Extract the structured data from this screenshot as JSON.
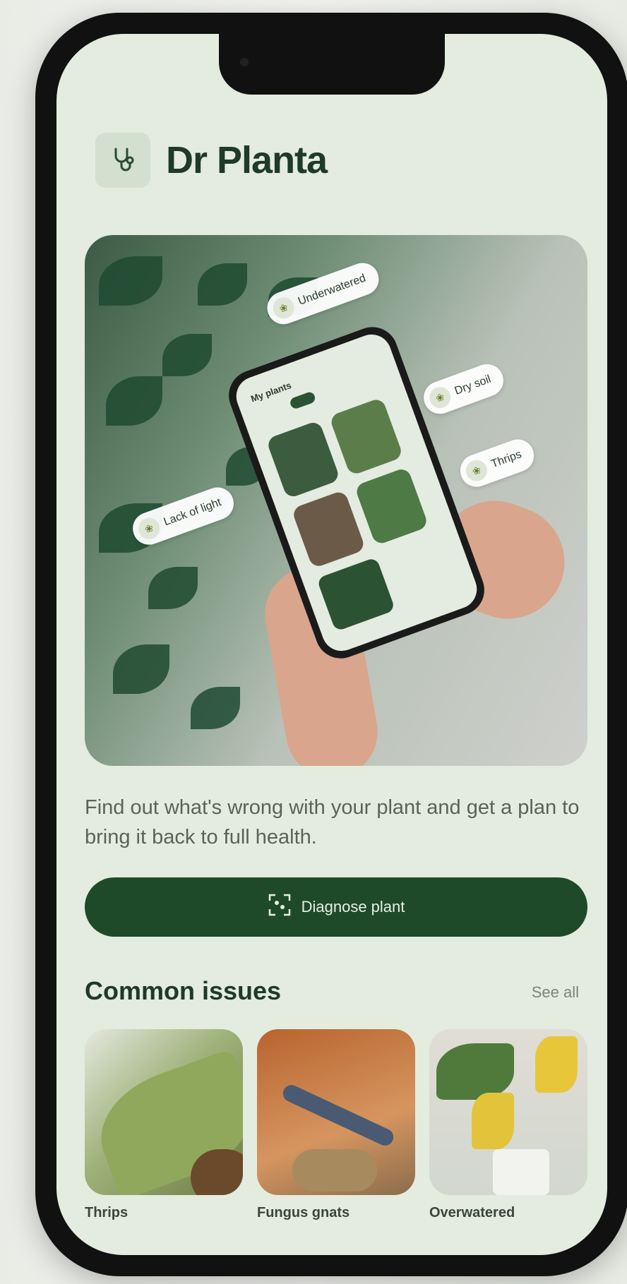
{
  "app": {
    "title": "Dr Planta",
    "logo_icon": "stethoscope-icon"
  },
  "hero": {
    "inner_phone_title": "My plants",
    "tags": [
      {
        "label": "Underwatered",
        "icon": "leaf-icon"
      },
      {
        "label": "Dry soil",
        "icon": "leaf-icon"
      },
      {
        "label": "Thrips",
        "icon": "leaf-icon"
      },
      {
        "label": "Lack of light",
        "icon": "leaf-icon"
      }
    ]
  },
  "description": "Find out what's wrong with your plant and get a plan to bring it back to full health.",
  "cta": {
    "label": "Diagnose plant",
    "icon": "scan-icon"
  },
  "common_issues": {
    "title": "Common issues",
    "see_all": "See all",
    "items": [
      {
        "label": "Thrips"
      },
      {
        "label": "Fungus gnats"
      },
      {
        "label": "Overwatered"
      }
    ]
  },
  "colors": {
    "primary": "#1e4a29",
    "background": "#e3ecdf",
    "text_dark": "#1f3a25"
  }
}
